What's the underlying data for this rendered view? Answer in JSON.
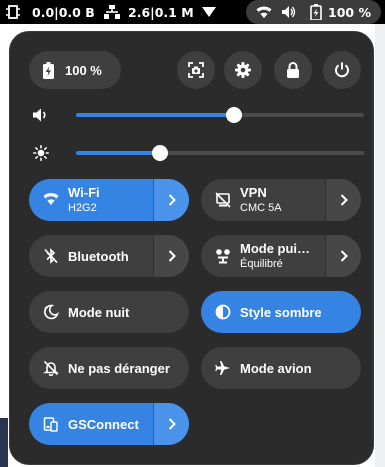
{
  "topbar": {
    "disk_io": "0.0|0.0 B",
    "net_io": "2.6|0.1 M",
    "battery": "100 %",
    "icons": [
      "cpu-icon",
      "network-wired-icon",
      "filter-icon",
      "wifi-icon",
      "volume-icon",
      "battery-icon"
    ]
  },
  "menu": {
    "battery_label": "100 %",
    "round_buttons": [
      "screenshot-icon",
      "settings-icon",
      "lock-icon",
      "power-icon"
    ],
    "sliders": {
      "volume": {
        "icon": "volume-icon",
        "level": 0.55
      },
      "brightness": {
        "icon": "brightness-icon",
        "level": 0.29
      }
    },
    "toggles": {
      "wifi": {
        "title": "Wi-Fi",
        "subtitle": "H2G2",
        "active": true
      },
      "vpn": {
        "title": "VPN",
        "subtitle": "CMC 5A",
        "active": false
      },
      "bluetooth": {
        "title": "Bluetooth",
        "active": false
      },
      "power_mode": {
        "title": "Mode pui…",
        "subtitle": "Équilibré",
        "active": false
      },
      "night_mode": {
        "title": "Mode nuit",
        "active": false
      },
      "dark_style": {
        "title": "Style sombre",
        "active": true
      },
      "dnd": {
        "title": "Ne pas déranger",
        "active": false
      },
      "airplane": {
        "title": "Mode avion",
        "active": false
      },
      "gsconnect": {
        "title": "GSConnect",
        "active": true
      }
    }
  },
  "colors": {
    "accent": "#3584e4",
    "menu_bg": "#2b2b2b",
    "button_bg": "#3f3f3f",
    "topbar_bg": "#000000"
  }
}
